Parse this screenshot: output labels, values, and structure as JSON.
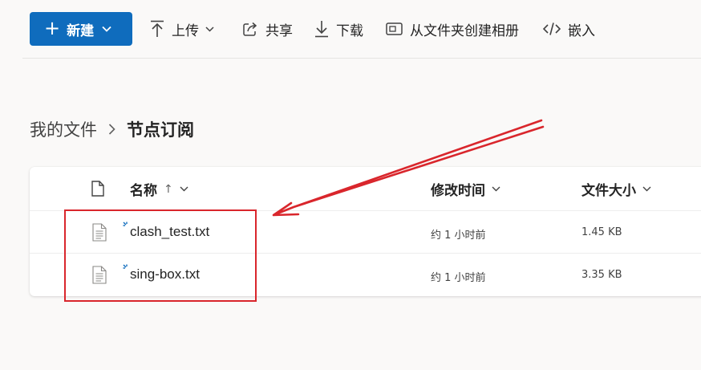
{
  "toolbar": {
    "new_label": "新建",
    "upload_label": "上传",
    "share_label": "共享",
    "download_label": "下载",
    "album_label": "从文件夹创建相册",
    "embed_label": "嵌入",
    "accent_color": "#0f6cbd"
  },
  "breadcrumb": {
    "root": "我的文件",
    "current": "节点订阅"
  },
  "file_list": {
    "columns": {
      "name": "名称",
      "modified": "修改时间",
      "size": "文件大小"
    },
    "sort_indicator": "↑",
    "rows": [
      {
        "name": "clash_test.txt",
        "modified": "约 1 小时前",
        "size": "1.45 KB"
      },
      {
        "name": "sing-box.txt",
        "modified": "约 1 小时前",
        "size": "3.35 KB"
      }
    ]
  },
  "annotation": {
    "color": "#d9262c"
  }
}
